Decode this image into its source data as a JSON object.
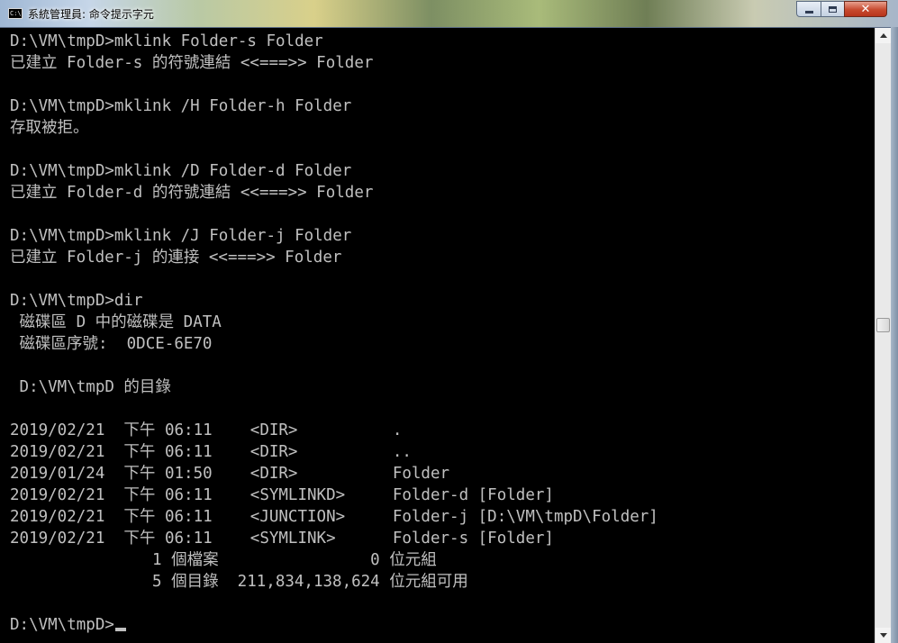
{
  "window": {
    "title": "系統管理員: 命令提示字元",
    "icon_text": "C:\\",
    "controls": {
      "minimize": "minimize",
      "maximize": "maximize",
      "close": "✕"
    }
  },
  "console": {
    "lines": [
      "D:\\VM\\tmpD>mklink Folder-s Folder",
      "已建立 Folder-s 的符號連結 <<===>> Folder",
      "",
      "D:\\VM\\tmpD>mklink /H Folder-h Folder",
      "存取被拒。",
      "",
      "D:\\VM\\tmpD>mklink /D Folder-d Folder",
      "已建立 Folder-d 的符號連結 <<===>> Folder",
      "",
      "D:\\VM\\tmpD>mklink /J Folder-j Folder",
      "已建立 Folder-j 的連接 <<===>> Folder",
      "",
      "D:\\VM\\tmpD>dir",
      " 磁碟區 D 中的磁碟是 DATA",
      " 磁碟區序號:  0DCE-6E70",
      "",
      " D:\\VM\\tmpD 的目錄",
      "",
      "2019/02/21  下午 06:11    <DIR>          .",
      "2019/02/21  下午 06:11    <DIR>          ..",
      "2019/01/24  下午 01:50    <DIR>          Folder",
      "2019/02/21  下午 06:11    <SYMLINKD>     Folder-d [Folder]",
      "2019/02/21  下午 06:11    <JUNCTION>     Folder-j [D:\\VM\\tmpD\\Folder]",
      "2019/02/21  下午 06:11    <SYMLINK>      Folder-s [Folder]",
      "               1 個檔案                0 位元組",
      "               5 個目錄  211,834,138,624 位元組可用",
      "",
      "D:\\VM\\tmpD>"
    ],
    "text_color": "#c0c0c0",
    "background_color": "#000000"
  },
  "scrollbar": {
    "up_arrow": "scroll-up-arrow",
    "down_arrow": "scroll-down-arrow"
  }
}
